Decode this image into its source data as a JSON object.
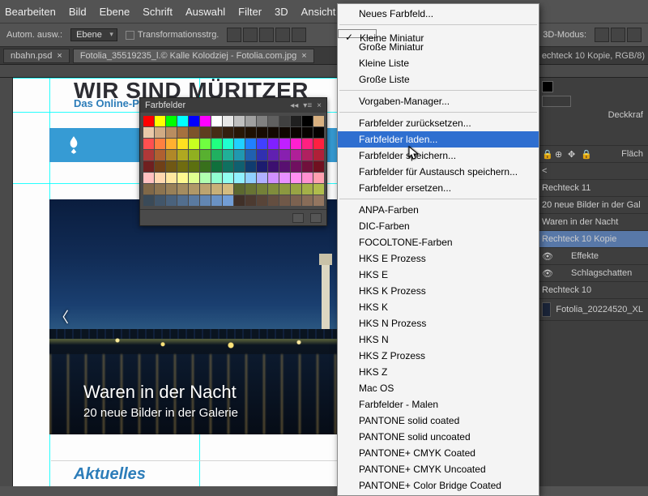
{
  "menubar": [
    "Bearbeiten",
    "Bild",
    "Ebene",
    "Schrift",
    "Auswahl",
    "Filter",
    "3D",
    "Ansicht"
  ],
  "optionsbar": {
    "auto_label": "Autom. ausw.:",
    "select_value": "Ebene",
    "transform_label": "Transformationsstrg.",
    "mode3d_label": "3D-Modus:"
  },
  "tabs": [
    {
      "label": "nbahn.psd",
      "close": "×",
      "active": false
    },
    {
      "label": "Fotolia_35519235_l.© Kalle Kolodziej - Fotolia.com.jpg",
      "close": "×",
      "active": true
    }
  ],
  "info_label": "echteck 10 Kopie, RGB/8)",
  "swatches": {
    "title": "Farbfelder"
  },
  "dropdown": {
    "items_top": [
      "Neues Farbfeld..."
    ],
    "items_thumb": [
      {
        "label": "Kleine Miniatur",
        "checked": true
      },
      {
        "label": "Große Miniatur",
        "checked": false
      },
      {
        "label": "Kleine Liste",
        "checked": false
      },
      {
        "label": "Große Liste",
        "checked": false
      }
    ],
    "items_mgr": [
      "Vorgaben-Manager..."
    ],
    "items_io": [
      "Farbfelder zurücksetzen...",
      "Farbfelder laden...",
      "Farbfelder speichern...",
      "Farbfelder für Austausch speichern...",
      "Farbfelder ersetzen..."
    ],
    "selected": "Farbfelder laden...",
    "items_libs": [
      "ANPA-Farben",
      "DIC-Farben",
      "FOCOLTONE-Farben",
      "HKS E Prozess",
      "HKS E",
      "HKS K Prozess",
      "HKS K",
      "HKS N Prozess",
      "HKS N",
      "HKS Z Prozess",
      "HKS Z",
      "Mac OS",
      "Farbfelder - Malen",
      "PANTONE solid coated",
      "PANTONE solid uncoated",
      "PANTONE+ CMYK Coated",
      "PANTONE+ CMYK Uncoated",
      "PANTONE+ Color Bridge Coated"
    ]
  },
  "page": {
    "title": "WIR SIND MÜRITZER",
    "subtitle": "Das Online-Po",
    "caption_title": "Waren in der Nacht",
    "caption_sub": "20 neue Bilder in der Galerie",
    "section": "Aktuelles"
  },
  "right": {
    "opacity_label": "Deckkraf",
    "fill_label": "Fläch",
    "lt": "<",
    "layers": [
      {
        "name": "Rechteck 11"
      },
      {
        "name": "20 neue Bilder in der Gal"
      },
      {
        "name": "Waren in der Nacht"
      },
      {
        "name": "Rechteck 10 Kopie",
        "selected": true
      },
      {
        "name": "Effekte",
        "indent": true,
        "eye": true
      },
      {
        "name": "Schlagschatten",
        "indent": true,
        "eye": true
      },
      {
        "name": "Rechteck 10"
      },
      {
        "name": "Fotolia_20224520_XL",
        "thumb": true
      }
    ]
  },
  "swatch_colors": [
    "#ff0000",
    "#ffff00",
    "#00ff00",
    "#00ffff",
    "#0000ff",
    "#ff00ff",
    "#ffffff",
    "#e8e8e8",
    "#c0c0c0",
    "#a0a0a0",
    "#808080",
    "#606060",
    "#404040",
    "#202020",
    "#000000",
    "#d8b080",
    "#eac9a9",
    "#d1ab84",
    "#b98d60",
    "#a5713f",
    "#7c532b",
    "#5e3d1f",
    "#452c16",
    "#331f0f",
    "#281707",
    "#1e1003",
    "#170b02",
    "#120801",
    "#0e0600",
    "#0a0400",
    "#070300",
    "#050200",
    "#ff5050",
    "#ff8040",
    "#ffb030",
    "#ffe020",
    "#c8ff20",
    "#70ff40",
    "#20ff80",
    "#20ffd0",
    "#20d0ff",
    "#2080ff",
    "#4040ff",
    "#8020ff",
    "#c020ff",
    "#ff20d0",
    "#ff2080",
    "#ff2040",
    "#b03838",
    "#b06030",
    "#b08828",
    "#b0a820",
    "#90b020",
    "#58b030",
    "#20b060",
    "#20b098",
    "#2098b0",
    "#2060b0",
    "#3030b0",
    "#6020b0",
    "#8820b0",
    "#b02098",
    "#b02060",
    "#b02038",
    "#702020",
    "#704018",
    "#705814",
    "#706c10",
    "#5c7010",
    "#38701c",
    "#10703c",
    "#107060",
    "#106070",
    "#103c70",
    "#1c1c70",
    "#3c1070",
    "#581070",
    "#701060",
    "#70103c",
    "#701020",
    "#ffc0c0",
    "#ffd8b0",
    "#ffe8a0",
    "#fff890",
    "#e0ff90",
    "#b0ffb0",
    "#90ffd0",
    "#90fff0",
    "#90f0ff",
    "#90d0ff",
    "#b0b0ff",
    "#d090ff",
    "#e890ff",
    "#ff90f0",
    "#ff90d0",
    "#ffa0b0",
    "#806848",
    "#8c7450",
    "#988058",
    "#a48c60",
    "#b09868",
    "#bca470",
    "#c8b078",
    "#d4bc80",
    "#5c6830",
    "#687434",
    "#748038",
    "#808c3c",
    "#8c9840",
    "#98a444",
    "#a4b048",
    "#b0bc4c",
    "#3a4a58",
    "#42566a",
    "#4a627c",
    "#526e8e",
    "#5a7aa0",
    "#6286b2",
    "#6a92c4",
    "#729ed6",
    "#403028",
    "#4c3a30",
    "#584438",
    "#644e40",
    "#705848",
    "#7c6250",
    "#886c58",
    "#947660"
  ]
}
